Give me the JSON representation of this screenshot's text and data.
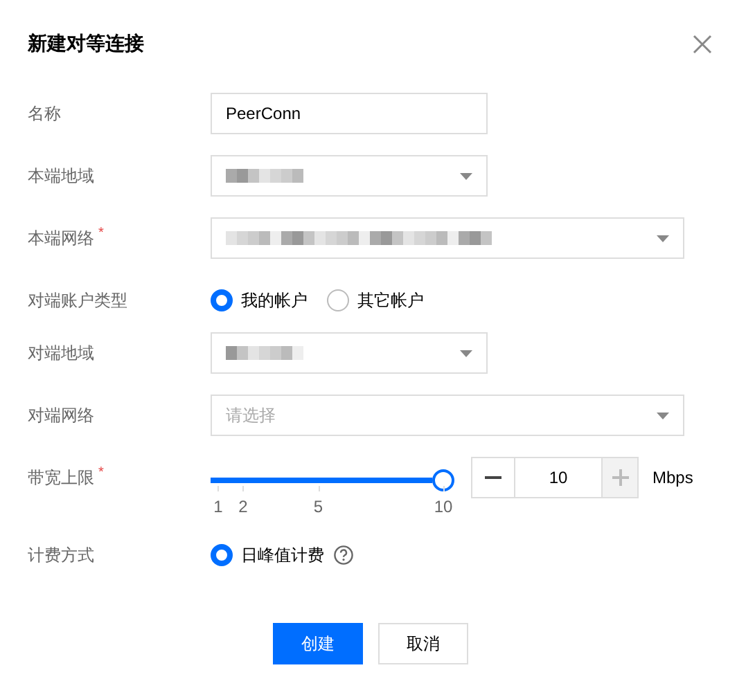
{
  "dialog": {
    "title": "新建对等连接"
  },
  "fields": [
    {
      "kind": "input",
      "label": "名称",
      "value": "PeerConn"
    },
    {
      "kind": "select",
      "label": "本端地域",
      "redacted": true
    },
    {
      "kind": "wide_select",
      "label": "本端网络",
      "required_mark": "*",
      "redacted": true
    },
    {
      "kind": "radio",
      "label": "对端账户类型",
      "options": [
        {
          "label": "我的帐户",
          "selected": true
        },
        {
          "label": "其它帐户",
          "selected": false
        }
      ]
    },
    {
      "kind": "select",
      "label": "对端地域",
      "redacted": true
    },
    {
      "kind": "wide_select",
      "label": "对端网络",
      "placeholder": "请选择"
    },
    {
      "kind": "slider",
      "label": "带宽上限",
      "required_mark": "*",
      "level": 1,
      "ticks": [
        "1",
        "2",
        "5",
        "10"
      ],
      "value": "10",
      "unit": "Mbps",
      "minus_disabled": false,
      "plus_disabled": true
    },
    {
      "kind": "radio",
      "label": "计费方式",
      "options": [
        {
          "label": "日峰值计费",
          "selected": true,
          "help": true
        }
      ]
    }
  ],
  "buttons": [
    {
      "label": "创建",
      "primary": true
    },
    {
      "label": "取消",
      "primary": false
    }
  ]
}
